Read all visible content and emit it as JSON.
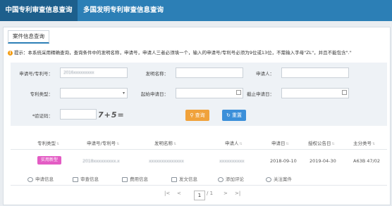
{
  "top_tabs": [
    {
      "label": "中国专利审查信息查询"
    },
    {
      "label": "多国发明专利审查信息查询"
    }
  ],
  "sub_tab": "案件信息查询",
  "notice": "提示：本系统采用精确查询，查询条件中的发明名称，申请号，申请人三者必须填一个，输入的申请号/专利号必须为9位或13位，不需输入字母\"ZL\"，并且不能包含\".\"",
  "form": {
    "application_no_label": "申请号/专利号：",
    "application_no_value": "2016xxxxxxxxx",
    "invention_name_label": "发明名称：",
    "applicant_label": "申请人：",
    "patent_type_label": "专利类型：",
    "start_date_label": "起始申请日：",
    "end_date_label": "截止申请日：",
    "captcha_label": "*验证码：",
    "captcha_text": "7+5=",
    "search_label": "查询",
    "reset_label": "重置"
  },
  "table": {
    "headers": [
      "专利类型",
      "申请号/专利号",
      "发明名称",
      "申请人",
      "申请日",
      "授权公告日",
      "主分类号"
    ],
    "rows": [
      {
        "type": "实用新型",
        "app_no": "2018xxxxxxxxx.x",
        "name": "xxxxxxxxxxxxxx",
        "applicant": "xxxxxxxxxx",
        "app_date": "2018-09-10",
        "grant_date": "2019-04-30",
        "class": "A63B 47/02"
      }
    ]
  },
  "actions": [
    "申请信息",
    "审查信息",
    "费用信息",
    "发文信息",
    "添加评论",
    "关注案件"
  ],
  "pager": {
    "first": "|<",
    "prev": "<",
    "current": "1",
    "total": "/ 1",
    "next": ">",
    "last": ">|"
  },
  "colors": {
    "topbar": "#2c7fb6",
    "active_tab": "#1d5f8c",
    "search_button": "#f0a23b",
    "reset_button": "#3b8fd9",
    "badge": "#e35cc4"
  }
}
